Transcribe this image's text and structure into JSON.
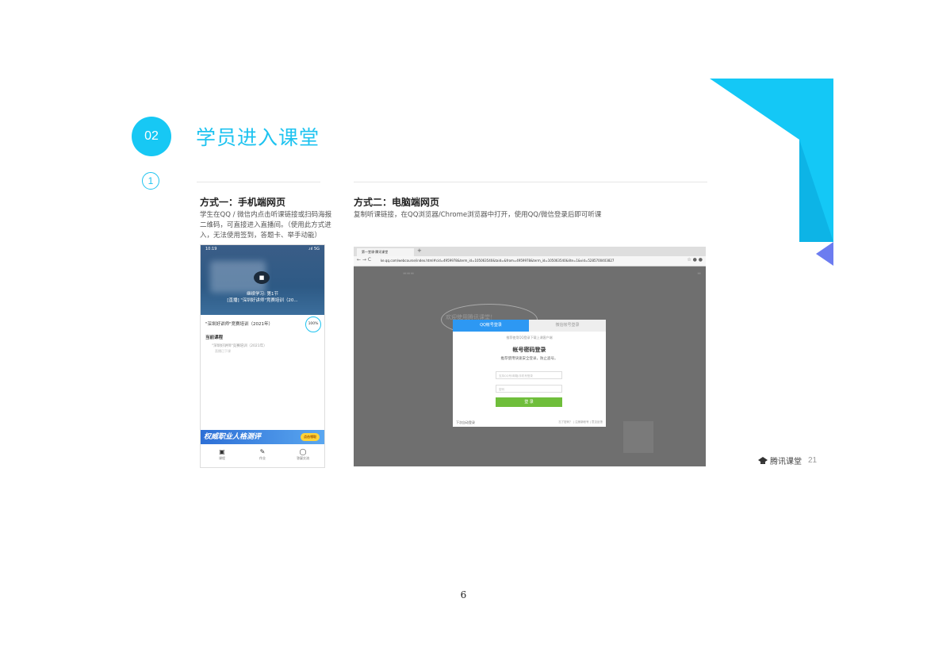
{
  "section": {
    "number": "02",
    "title": "学员进入课堂",
    "step": "1"
  },
  "method1": {
    "title": "方式一：手机端网页",
    "desc": "学生在QQ / 微信内点击听课链接或扫码海报二维码，可直接进入直播间。（使用此方式进入，无法使用签到，答题卡、举手动能）",
    "phone": {
      "time": "10:19",
      "signal": ".ııl 5G",
      "watch_line1": "继续学习: 第1节",
      "watch_line2": "[直播] \"深圳好讲师\"竞赛培训（20...",
      "course_title": "\"深圳好讲师\"竞赛培训（2021年）",
      "progress": "100%",
      "current_label": "当前课程",
      "current_item": "\"深圳好讲师\"竞赛培训（2021年）",
      "current_sub": "直播已下课",
      "banner_text": "权威职业人格测评",
      "banner_button": "点击领取",
      "tabs": [
        "课程",
        "作业",
        "答疑交流"
      ]
    }
  },
  "method2": {
    "title": "方式二：电脑端网页",
    "desc": "复制听课链接，在QQ浏览器/Chrome浏览器中打开，使用QQ/微信登录后即可听课",
    "browser": {
      "tab_label": "第一堂课·腾讯课堂",
      "url": "ke.qq.com/webcourse/index.html#cid=4959978&term_id=105063540&taid=&from=4959978&term_id=105063540&lite=1&vid=5285700403827",
      "welcome": "欢迎使用腾讯课堂！",
      "login": {
        "tab_qq": "QQ帐号登录",
        "tab_wechat": "微信帐号登录",
        "hint": "推荐使用QQ登录下载上课客户端",
        "heading": "帐号密码登录",
        "sub": "推荐使用快速安全登录，防止盗号。",
        "account_placeholder": "支持QQ号/邮箱/手机号登录",
        "password_placeholder": "密码",
        "submit": "登 录",
        "footer_left": "下次自动登录",
        "footer_right": "忘了密码？ | 注册新帐号 | 意见反馈"
      }
    }
  },
  "footer": {
    "brand": "腾讯课堂",
    "slide_page": "21",
    "page_number": "6"
  },
  "colors": {
    "accent": "#17c8f4",
    "purple": "#6c7cf0",
    "login_green": "#6fbe3b",
    "qq_blue": "#2d98f3"
  }
}
